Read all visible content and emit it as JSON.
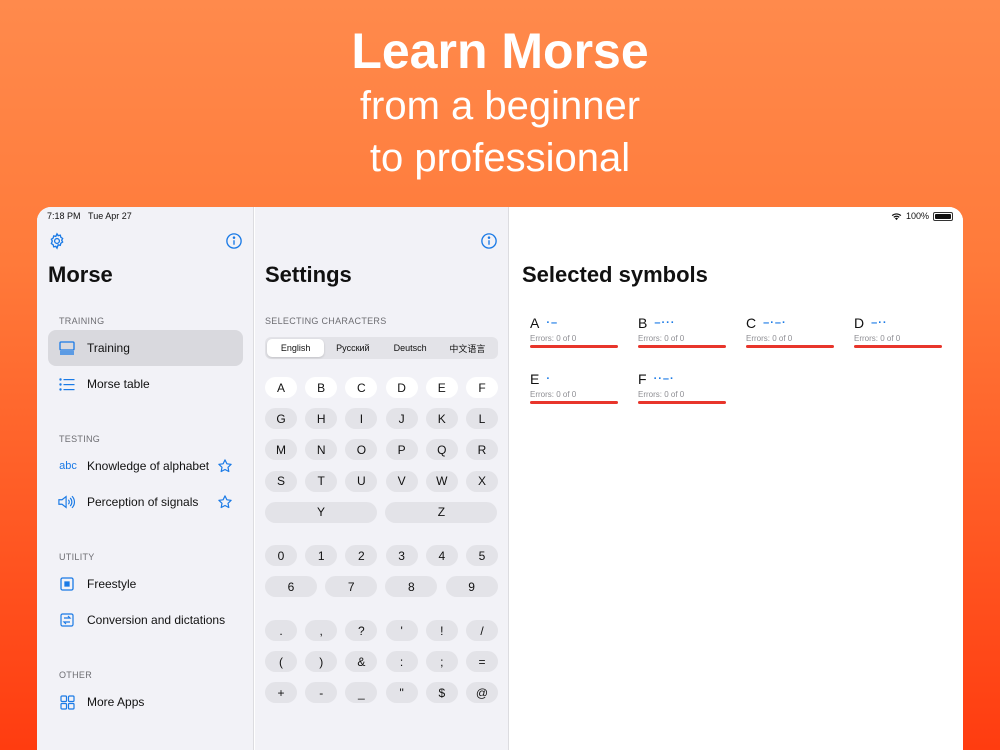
{
  "promo": {
    "headline": "Learn Morse",
    "subline1": "from a beginner",
    "subline2": "to professional"
  },
  "status_bar": {
    "time": "7:18 PM",
    "date": "Tue Apr 27",
    "battery": "100%"
  },
  "sidebar": {
    "title": "Morse",
    "sections": [
      {
        "header": "TRAINING",
        "items": [
          {
            "label": "Training",
            "icon": "training-icon",
            "active": true
          },
          {
            "label": "Morse table",
            "icon": "list-icon"
          }
        ]
      },
      {
        "header": "TESTING",
        "items": [
          {
            "label": "Knowledge of alphabet",
            "icon": "abc-icon",
            "icon_text": "abc"
          },
          {
            "label": "Perception of signals",
            "icon": "speaker-icon"
          }
        ]
      },
      {
        "header": "UTILITY",
        "items": [
          {
            "label": "Freestyle",
            "icon": "freestyle-icon"
          },
          {
            "label": "Conversion and dictations",
            "icon": "conversion-icon"
          }
        ]
      },
      {
        "header": "OTHER",
        "items": [
          {
            "label": "More Apps",
            "icon": "grid-icon"
          }
        ]
      }
    ]
  },
  "settings": {
    "title": "Settings",
    "section_header": "SELECTING CHARACTERS",
    "languages": [
      "English",
      "Русский",
      "Deutsch",
      "中文语言"
    ],
    "selected_language": "English",
    "letter_rows": [
      [
        "A",
        "B",
        "C",
        "D",
        "E",
        "F"
      ],
      [
        "G",
        "H",
        "I",
        "J",
        "K",
        "L"
      ],
      [
        "M",
        "N",
        "O",
        "P",
        "Q",
        "R"
      ],
      [
        "S",
        "T",
        "U",
        "V",
        "W",
        "X"
      ],
      [
        "Y",
        "Z"
      ]
    ],
    "digit_rows": [
      [
        "0",
        "1",
        "2",
        "3",
        "4",
        "5"
      ],
      [
        "6",
        "7",
        "8",
        "9"
      ]
    ],
    "punct_rows": [
      [
        ".",
        ",",
        "?",
        "'",
        "!",
        "/"
      ],
      [
        "(",
        ")",
        "&",
        ":",
        ";",
        "="
      ],
      [
        "+",
        "-",
        "_",
        "\"",
        "$",
        "@"
      ]
    ],
    "selected_keys": [
      "A",
      "B",
      "C",
      "D",
      "E",
      "F"
    ]
  },
  "detail": {
    "title": "Selected symbols",
    "symbols": [
      {
        "letter": "A",
        "code": "·–",
        "errors": "Errors: 0 of 0"
      },
      {
        "letter": "B",
        "code": "–···",
        "errors": "Errors: 0 of 0"
      },
      {
        "letter": "C",
        "code": "–·–·",
        "errors": "Errors: 0 of 0"
      },
      {
        "letter": "D",
        "code": "–··",
        "errors": "Errors: 0 of 0"
      },
      {
        "letter": "E",
        "code": "·",
        "errors": "Errors: 0 of 0"
      },
      {
        "letter": "F",
        "code": "··–·",
        "errors": "Errors: 0 of 0"
      }
    ]
  },
  "colors": {
    "accent": "#1a7ae6",
    "error_bar": "#e8352b",
    "promo_top": "#ff8a4c",
    "promo_bottom": "#ff3c10"
  }
}
